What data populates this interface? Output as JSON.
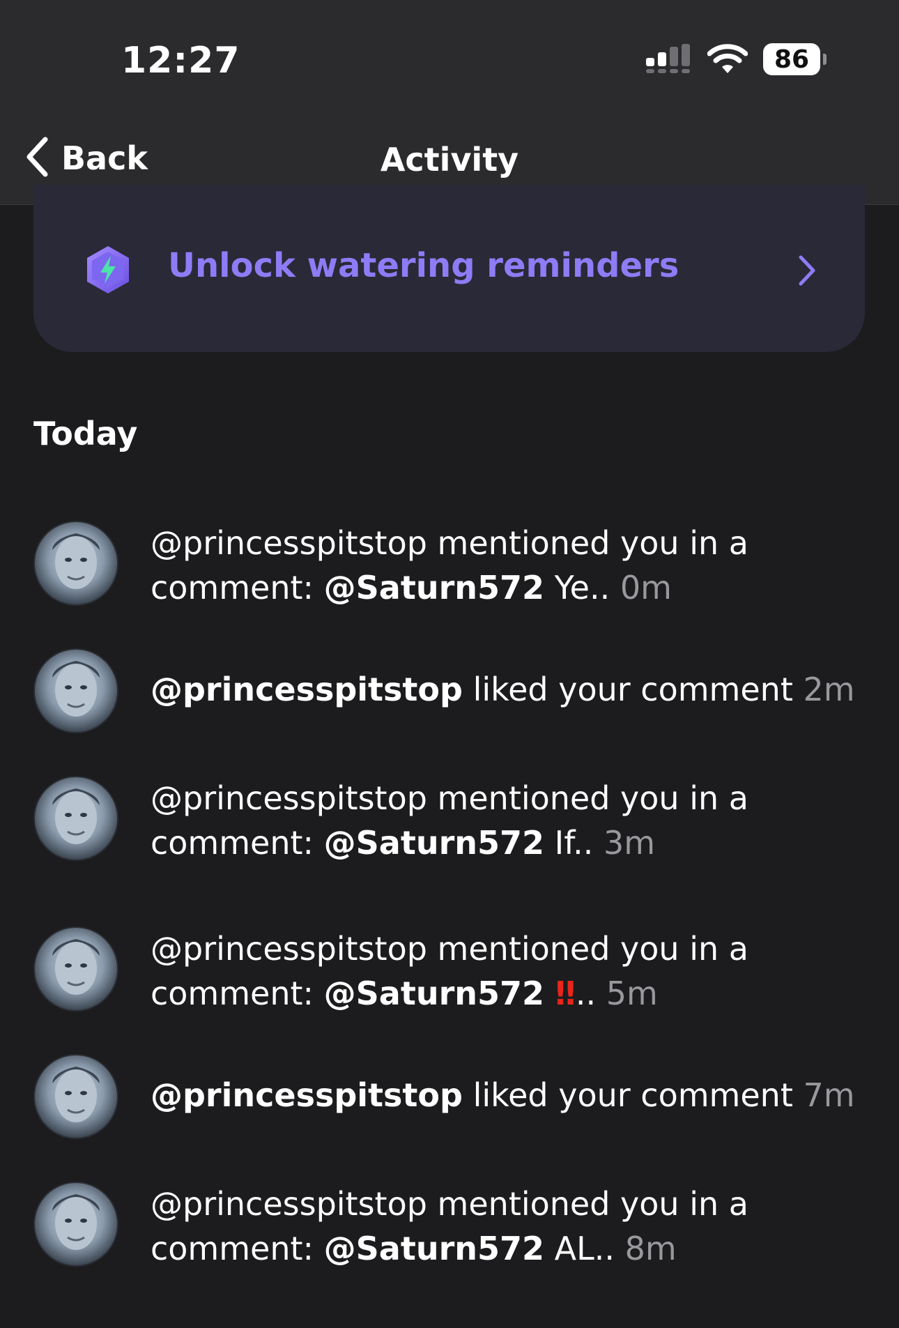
{
  "status_bar": {
    "time": "12:27",
    "battery": "86"
  },
  "nav": {
    "back_label": "Back",
    "title": "Activity"
  },
  "banner": {
    "text": "Unlock watering reminders",
    "accent": "#8d7cf5"
  },
  "section": {
    "title": "Today"
  },
  "activity": [
    {
      "text": "@princesspitstop mentioned you in a comment: ",
      "mention": "@Saturn572",
      "snippet": " Ye..",
      "time": " 0m"
    },
    {
      "user": "@princesspitstop",
      "text": " liked your comment",
      "time": " 2m"
    },
    {
      "text": "@princesspitstop mentioned you in a comment: ",
      "mention": "@Saturn572",
      "snippet": " If..",
      "time": " 3m"
    },
    {
      "text": "@princesspitstop mentioned you in a comment: ",
      "mention": "@Saturn572",
      "emoji": " ‼",
      "snippet": "..",
      "time": " 5m"
    },
    {
      "user": "@princesspitstop",
      "text": " liked your comment",
      "time": " 7m"
    },
    {
      "text": "@princesspitstop mentioned you in a comment: ",
      "mention": "@Saturn572",
      "snippet": " AL..",
      "time": " 8m"
    }
  ]
}
